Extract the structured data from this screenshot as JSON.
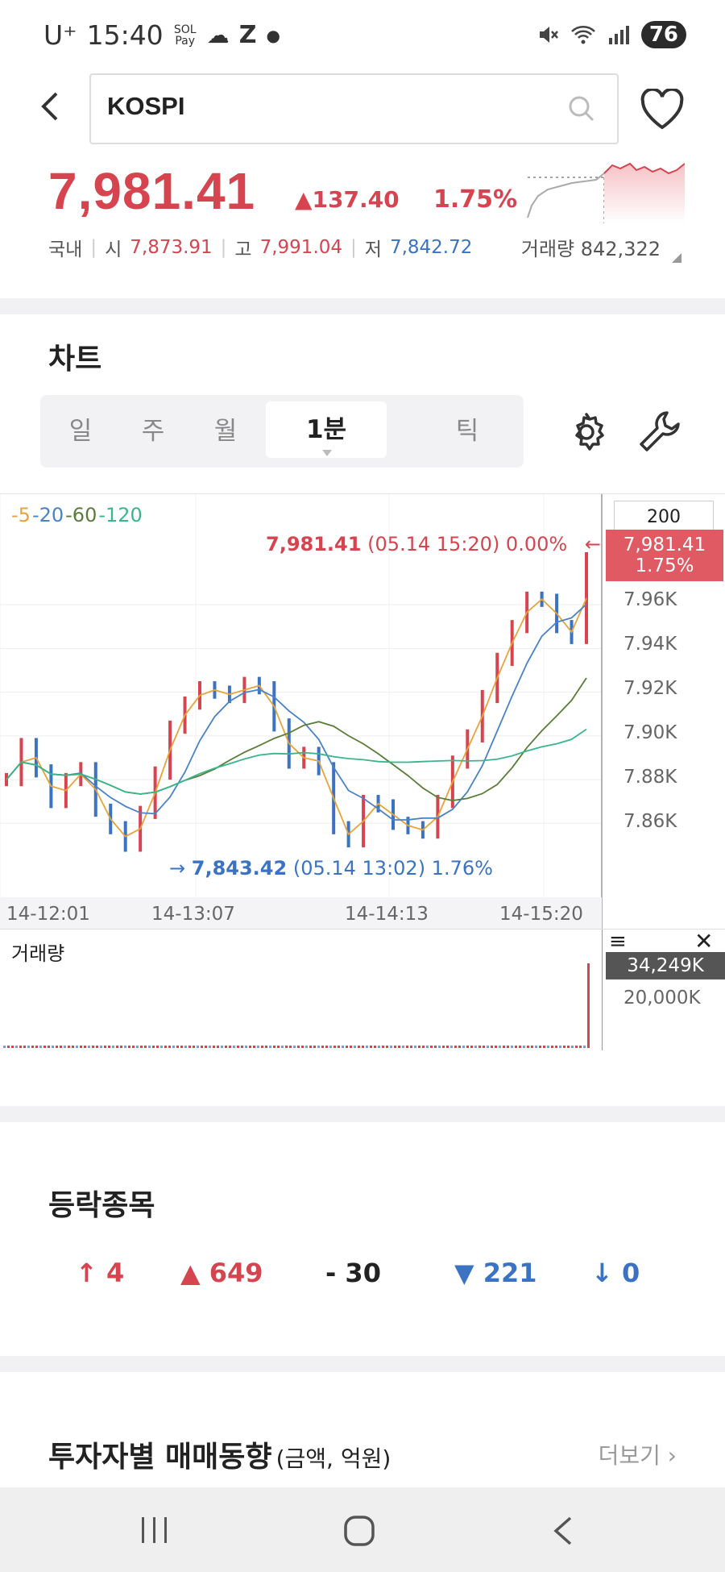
{
  "status_bar": {
    "carrier": "U⁺",
    "time": "15:40",
    "sol_pay": "SOL Pay",
    "battery": "76"
  },
  "search": {
    "query": "KOSPI"
  },
  "quote": {
    "price": "7,981.41",
    "change": "▲137.40",
    "change_pct": "1.75%",
    "market": "국내",
    "open_label": "시",
    "open": "7,873.91",
    "high_label": "고",
    "high": "7,991.04",
    "low_label": "저",
    "low": "7,842.72",
    "volume_label": "거래량",
    "volume": "842,322"
  },
  "chart_section": {
    "title": "차트",
    "tabs": [
      "일",
      "주",
      "월",
      "1분",
      "틱"
    ],
    "active_tab": "1분"
  },
  "chart": {
    "ma_legend": [
      {
        "label": "-5",
        "color": "#e8a33a"
      },
      {
        "label": "-20",
        "color": "#4a82c8"
      },
      {
        "label": "-60",
        "color": "#5a7d3a"
      },
      {
        "label": "-120",
        "color": "#3bb58a"
      }
    ],
    "count_box": "200",
    "current_label": "7,981.41",
    "current_pct": "1.75%",
    "high_annot_price": "7,981.41",
    "high_annot_rest": "(05.14 15:20) 0.00%",
    "low_annot_price": "7,843.42",
    "low_annot_rest": "(05.14 13:02) 1.76%",
    "x_labels": [
      "14-12:01",
      "14-13:07",
      "14-14:13",
      "14-15:20"
    ],
    "y_labels": [
      "7.96K",
      "7.94K",
      "7.92K",
      "7.90K",
      "7.88K",
      "7.86K"
    ],
    "volume_title": "거래량",
    "volume_current": "34,249K",
    "volume_axis": "20,000K"
  },
  "chart_data": {
    "type": "line",
    "title": "",
    "xlabel": "",
    "ylabel": "",
    "x": [
      "14-12:01",
      "14-13:07",
      "14-14:13",
      "14-15:20"
    ],
    "ylim": [
      7840,
      7985
    ],
    "series": [
      {
        "name": "",
        "values": [
          7880,
          7896,
          7884,
          7870,
          7880,
          7885,
          7866,
          7858,
          7850,
          7865,
          7883,
          7904,
          7915,
          7922,
          7920,
          7918,
          7924,
          7922,
          7905,
          7888,
          7892,
          7885,
          7858,
          7852,
          7870,
          7868,
          7860,
          7858,
          7856,
          7870,
          7888,
          7900,
          7918,
          7935,
          7950,
          7963,
          7962,
          7950,
          7945,
          7981
        ]
      }
    ]
  },
  "advance_decline": {
    "title": "등락종목",
    "upper_limit": "4",
    "up": "649",
    "unchanged": "30",
    "down": "221",
    "lower_limit": "0"
  },
  "investor": {
    "title": "투자자별 매매동향",
    "subtitle": "(금액, 억원)",
    "more": "더보기"
  },
  "colors": {
    "up": "#d6454f",
    "down": "#3b73c4",
    "accent_red": "#e05a63"
  }
}
